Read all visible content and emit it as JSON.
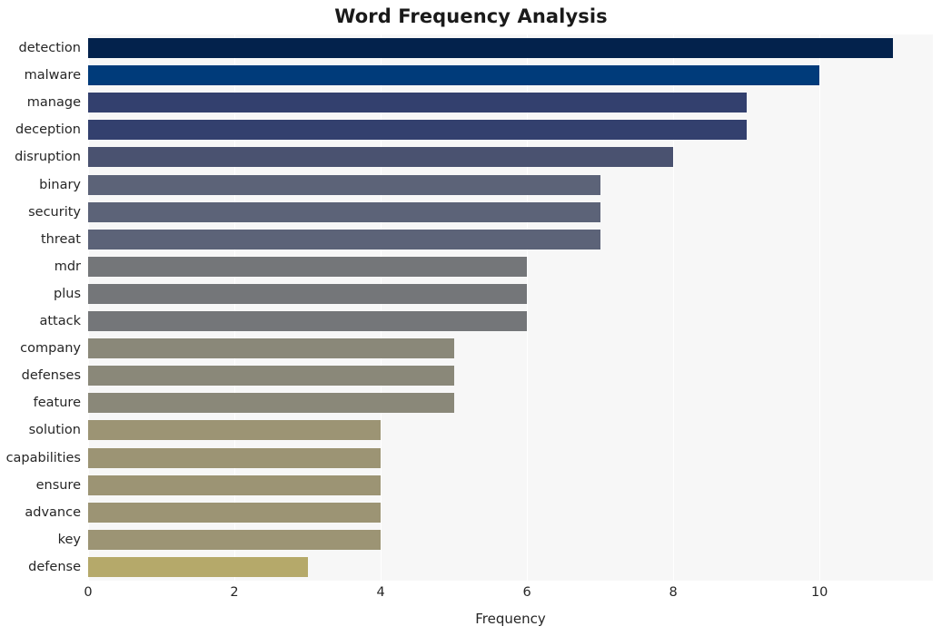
{
  "chart_data": {
    "type": "bar",
    "orientation": "horizontal",
    "title": "Word Frequency Analysis",
    "xlabel": "Frequency",
    "ylabel": "",
    "xlim": [
      0,
      11.55
    ],
    "xticks": [
      0,
      2,
      4,
      6,
      8,
      10
    ],
    "xticklabels": [
      "0",
      "2",
      "4",
      "6",
      "8",
      "10"
    ],
    "grid": "vertical-white-on-light-gray",
    "legend": "none",
    "categories": [
      "detection",
      "malware",
      "manage",
      "deception",
      "disruption",
      "binary",
      "security",
      "threat",
      "mdr",
      "plus",
      "attack",
      "company",
      "defenses",
      "feature",
      "solution",
      "capabilities",
      "ensure",
      "advance",
      "key",
      "defense"
    ],
    "values": [
      11,
      10,
      9,
      9,
      8,
      7,
      7,
      7,
      6,
      6,
      6,
      5,
      5,
      5,
      4,
      4,
      4,
      4,
      4,
      3
    ],
    "bar_colors": [
      "#03224c",
      "#003b7a",
      "#33406e",
      "#33406e",
      "#4a5270",
      "#5c6378",
      "#5c6378",
      "#5c6378",
      "#747679",
      "#747679",
      "#747679",
      "#8a8879",
      "#8a8879",
      "#8a8879",
      "#9c9474",
      "#9c9474",
      "#9c9474",
      "#9c9474",
      "#9c9474",
      "#b5a96a"
    ],
    "plot_background": "#f7f7f7",
    "gridline_color": "#ffffff",
    "page_background": "#ffffff"
  }
}
